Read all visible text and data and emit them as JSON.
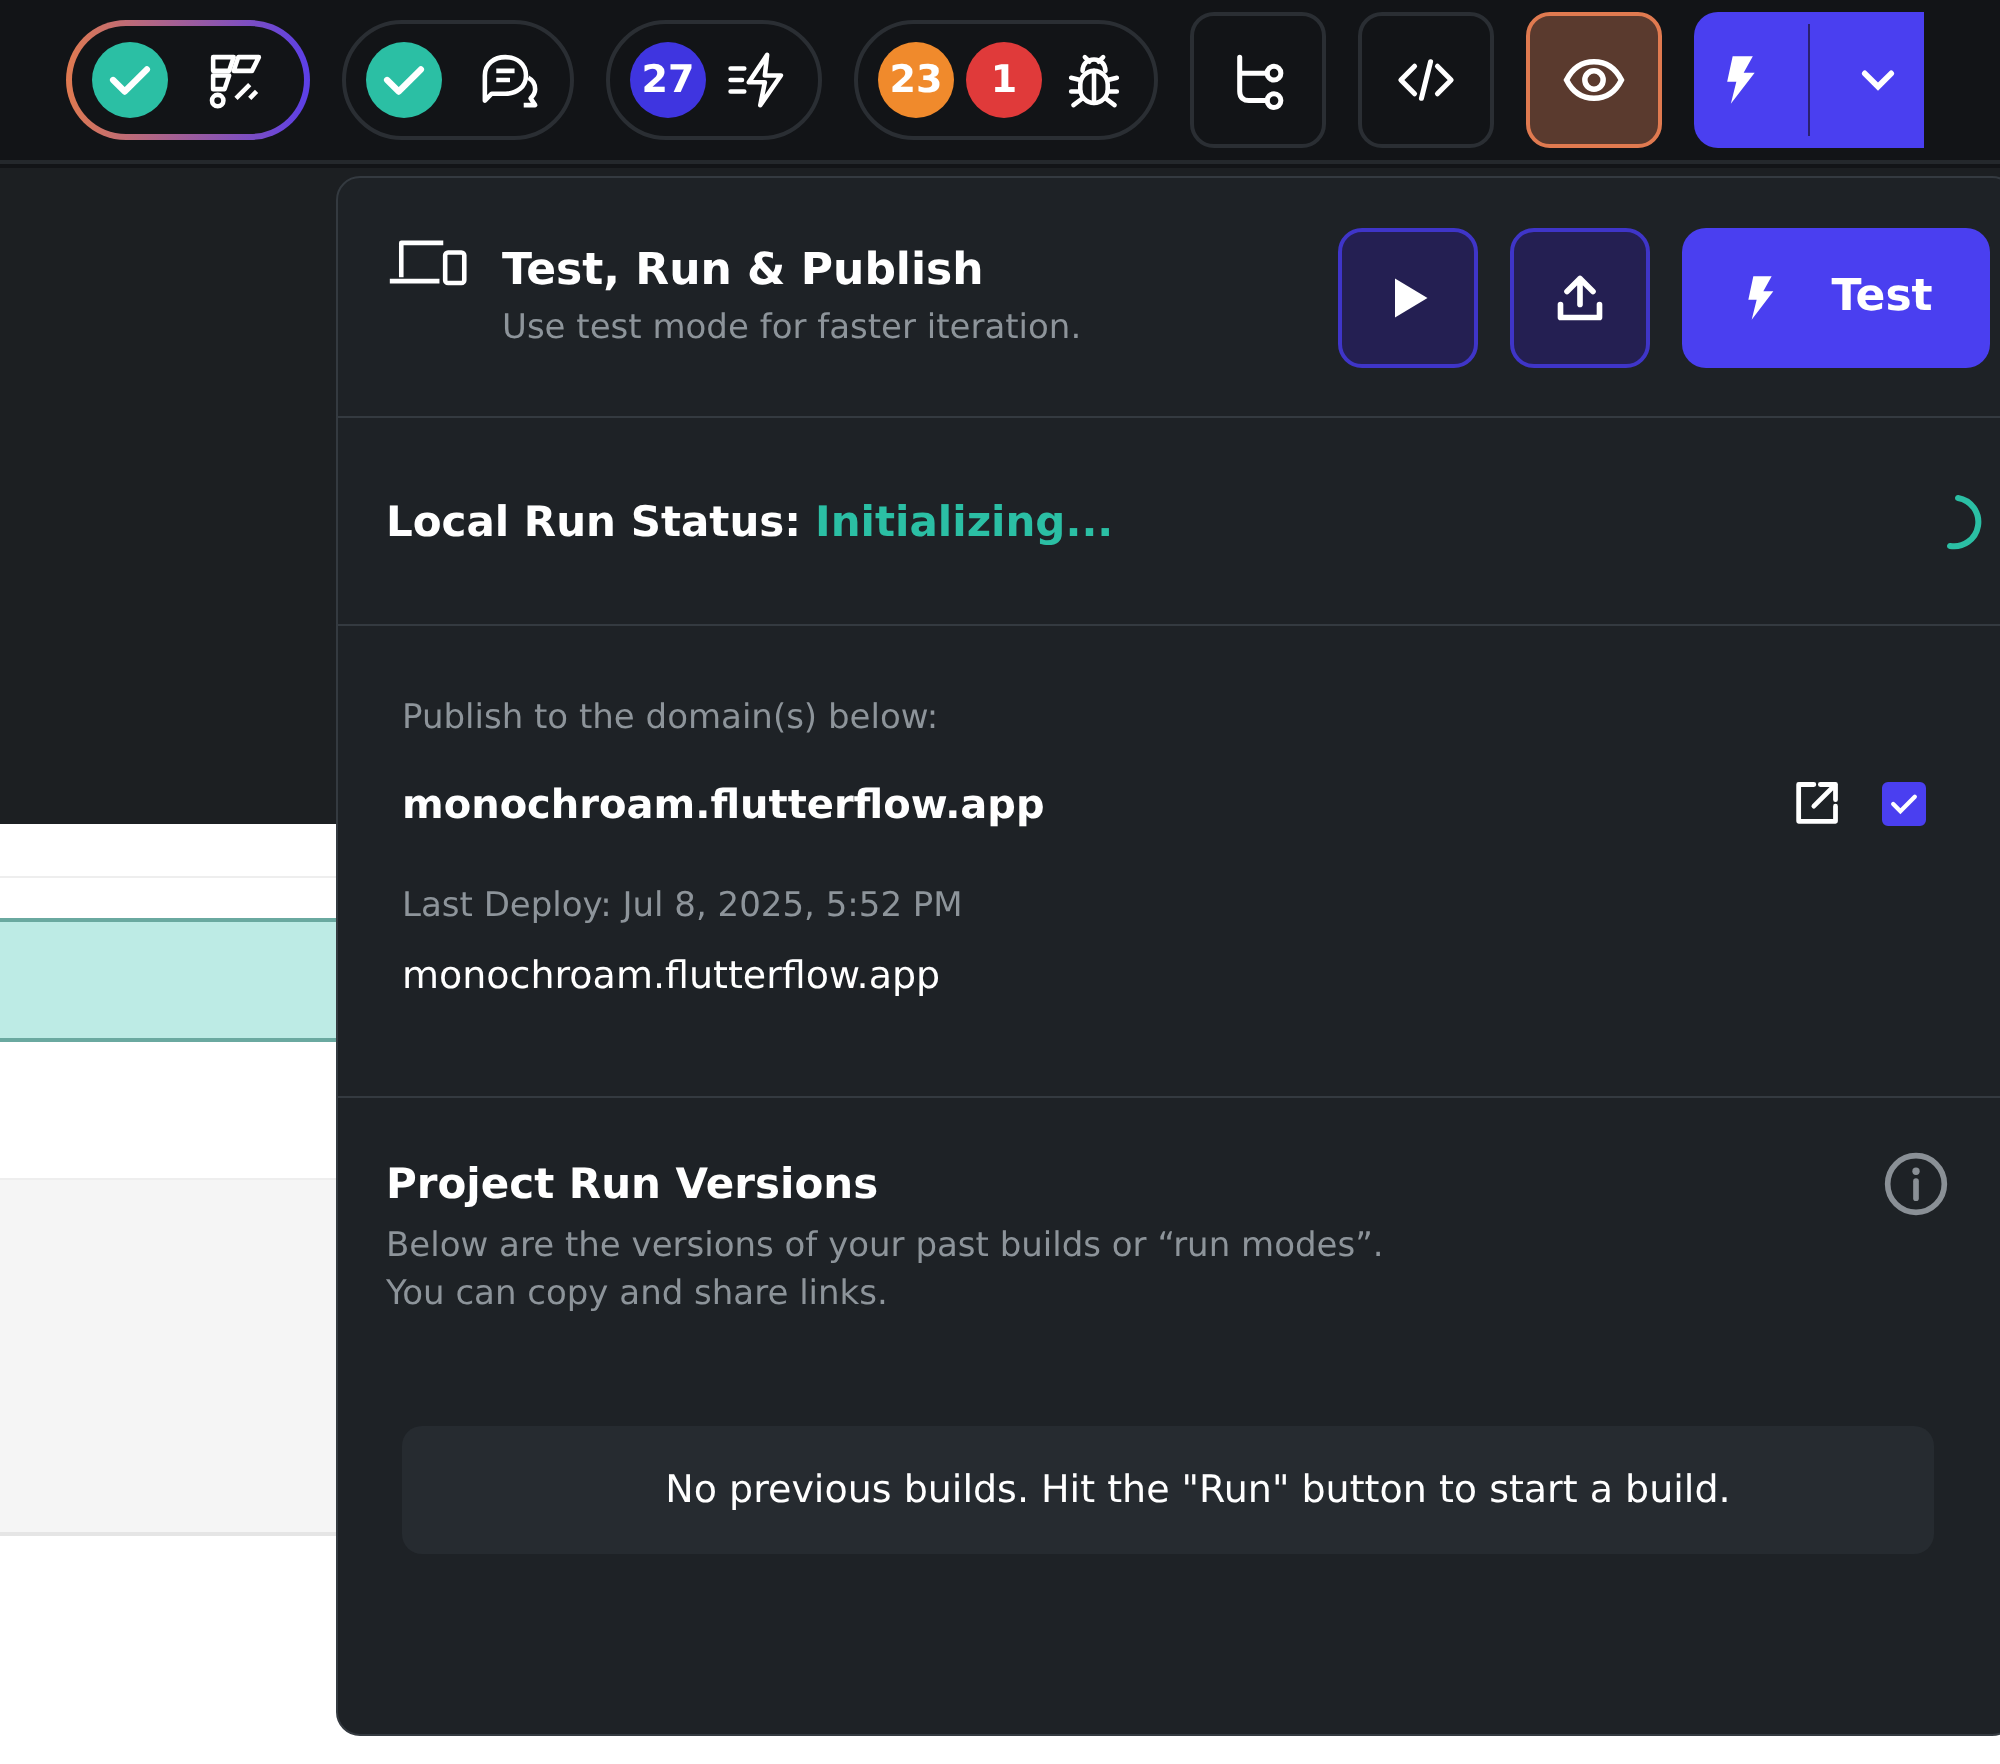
{
  "toolbar": {
    "groups": [
      {
        "kind": "check-flow"
      },
      {
        "kind": "check-chat"
      },
      {
        "kind": "actions",
        "badges": [
          {
            "count": "27",
            "color": "#3f35e0"
          }
        ]
      },
      {
        "kind": "bug",
        "badges": [
          {
            "count": "23",
            "color": "#f08a2c"
          },
          {
            "count": "1",
            "color": "#e03a3a"
          }
        ]
      }
    ],
    "preview_active": true
  },
  "popover": {
    "title": "Test, Run & Publish",
    "subtitle": "Use test mode for faster iteration.",
    "test_button": "Test",
    "status_label": "Local Run Status:",
    "status_value": "Initializing...",
    "publish_label": "Publish to the domain(s) below:",
    "domain": "monochroam.flutterflow.app",
    "domain_checked": true,
    "last_deploy": "Last Deploy: Jul 8, 2025, 5:52 PM",
    "deploy_domain": "monochroam.flutterflow.app",
    "versions_title": "Project Run Versions",
    "versions_lines": [
      "Below are the versions of your past builds or “run modes”.",
      "You can copy and share links."
    ],
    "empty_message": "No previous builds. Hit the \"Run\" button to start a build."
  }
}
